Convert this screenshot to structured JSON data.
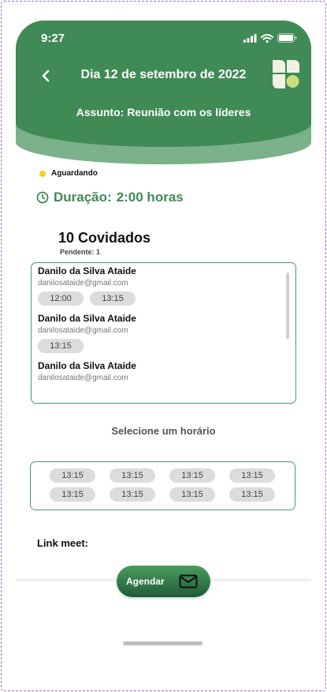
{
  "status_bar": {
    "time": "9:27"
  },
  "header": {
    "title": "Dia 12 de setembro de 2022",
    "subject": "Assunto: Reunião com os líderes"
  },
  "meeting": {
    "status": "Aguardando",
    "status_color": "#f2d51c",
    "duration_label": "Duração:",
    "duration_value": "2:00 horas"
  },
  "guests": {
    "title": "10 Covidados",
    "pending": "Pendente: 1",
    "items": [
      {
        "name": "Danilo da Silva Ataide",
        "email": "danilosataide@gmail.com",
        "times": [
          "12:00",
          "13:15"
        ]
      },
      {
        "name": "Danilo da Silva Ataide",
        "email": "danilosataide@gmail.com",
        "times": [
          "13:15"
        ]
      },
      {
        "name": "Danilo da Silva Ataide",
        "email": "danilosataide@gmail.com",
        "times": []
      }
    ]
  },
  "time_selection": {
    "label": "Selecione um horário",
    "slots": [
      "13:15",
      "13:15",
      "13:15",
      "13:15",
      "13:15",
      "13:15",
      "13:15",
      "13:15"
    ]
  },
  "link": {
    "label": "Link meet:"
  },
  "actions": {
    "schedule_label": "Agendar"
  },
  "colors": {
    "primary": "#3f8a55",
    "primary_light": "#7ab18b",
    "chip": "#dcdcdc",
    "border": "#4c9a63"
  },
  "icons": [
    "back-chevron-icon",
    "app-logo-icon",
    "clock-icon",
    "mail-icon",
    "signal-icon",
    "wifi-icon",
    "battery-icon"
  ]
}
